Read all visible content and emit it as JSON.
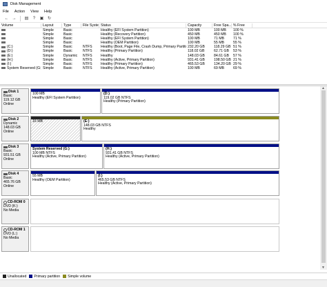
{
  "window": {
    "title": "Disk Management"
  },
  "menu": [
    "File",
    "Action",
    "View",
    "Help"
  ],
  "toolbar_icons": [
    "back-icon",
    "forward-icon",
    "list-view-icon",
    "help-icon",
    "properties-icon",
    "refresh-icon"
  ],
  "volumes": {
    "headers": [
      "Volume",
      "Layout",
      "Type",
      "File System",
      "Status",
      "Capacity",
      "Free Spa...",
      "% Free"
    ],
    "rows": [
      [
        "",
        "Simple",
        "Basic",
        "",
        "Healthy (EFI System Partition)",
        "100 MB",
        "100 MB",
        "100 %"
      ],
      [
        "",
        "Simple",
        "Basic",
        "",
        "Healthy (Recovery Partition)",
        "450 MB",
        "450 MB",
        "100 %"
      ],
      [
        "",
        "Simple",
        "Basic",
        "",
        "Healthy (EFI System Partition)",
        "100 MB",
        "71 MB",
        "71 %"
      ],
      [
        "",
        "Simple",
        "Basic",
        "",
        "Healthy (OEM Partition)",
        "100 MB",
        "55 MB",
        "55 %"
      ],
      [
        "(C:)",
        "Simple",
        "Basic",
        "NTFS",
        "Healthy (Boot, Page File, Crash Dump, Primary Partition)",
        "232.20 GB",
        "118.29 GB",
        "51 %"
      ],
      [
        "(D:)",
        "Simple",
        "Basic",
        "NTFS",
        "Healthy (Primary Partition)",
        "118.02 GB",
        "62.71 GB",
        "53 %"
      ],
      [
        "(E:)",
        "Simple",
        "Dynamic",
        "NTFS",
        "Healthy",
        "148.03 GB",
        "84.61 GB",
        "57 %"
      ],
      [
        "(H:)",
        "Simple",
        "Basic",
        "NTFS",
        "Healthy (Active, Primary Partition)",
        "931.41 GB",
        "198.50 GB",
        "21 %"
      ],
      [
        "(I:)",
        "Simple",
        "Basic",
        "NTFS",
        "Healthy (Primary Partition)",
        "465.53 GB",
        "134.20 GB",
        "29 %"
      ],
      [
        "System Reserved (G:)",
        "Simple",
        "Basic",
        "NTFS",
        "Healthy (Active, Primary Partition)",
        "100 MB",
        "69 MB",
        "69 %"
      ]
    ]
  },
  "disks": [
    {
      "name": "Disk 1",
      "type": "Basic",
      "size": "119.12 GB",
      "state": "Online",
      "media": "hdd",
      "partitions": [
        {
          "label": "",
          "line1": "100 MB",
          "line2": "Healthy (EFI System Partition)",
          "kind": "primary"
        },
        {
          "label": "(D:)",
          "line1": "119.02 GB NTFS",
          "line2": "Healthy (Primary Partition)",
          "kind": "primary"
        }
      ]
    },
    {
      "name": "Disk 2",
      "type": "Dynamic",
      "size": "148.03 GB",
      "state": "Online",
      "media": "hdd",
      "partitions": [
        {
          "label": "",
          "line1": "16 MB",
          "line2": "Unallocated",
          "kind": "unalloc"
        },
        {
          "label": "(E:)",
          "line1": "148.03 GB NTFS",
          "line2": "Healthy",
          "kind": "simple"
        }
      ]
    },
    {
      "name": "Disk 3",
      "type": "Basic",
      "size": "931.51 GB",
      "state": "Online",
      "media": "hdd",
      "partitions": [
        {
          "label": "System Reserved (G:)",
          "line1": "100 MB NTFS",
          "line2": "Healthy (Active, Primary Partition)",
          "kind": "primary"
        },
        {
          "label": "(H:)",
          "line1": "931.41 GB NTFS",
          "line2": "Healthy (Active, Primary Partition)",
          "kind": "primary"
        }
      ]
    },
    {
      "name": "Disk 4",
      "type": "Basic",
      "size": "465.76 GB",
      "state": "Online",
      "media": "hdd",
      "partitions": [
        {
          "label": "",
          "line1": "55 MB",
          "line2": "Healthy (OEM Partition)",
          "kind": "primary"
        },
        {
          "label": "(I:)",
          "line1": "465.53 GB NTFS",
          "line2": "Healthy (Active, Primary Partition)",
          "kind": "primary"
        }
      ]
    },
    {
      "name": "CD-ROM 0",
      "type": "DVD (K:)",
      "size": "",
      "state": "No Media",
      "media": "cd",
      "partitions": []
    },
    {
      "name": "CD-ROM 1",
      "type": "DVD (L:)",
      "size": "",
      "state": "No Media",
      "media": "cd",
      "partitions": []
    }
  ],
  "legend": [
    {
      "label": "Unallocated",
      "color": "#222222"
    },
    {
      "label": "Primary partition",
      "color": "#000f87"
    },
    {
      "label": "Simple volume",
      "color": "#8a8a1e"
    }
  ]
}
